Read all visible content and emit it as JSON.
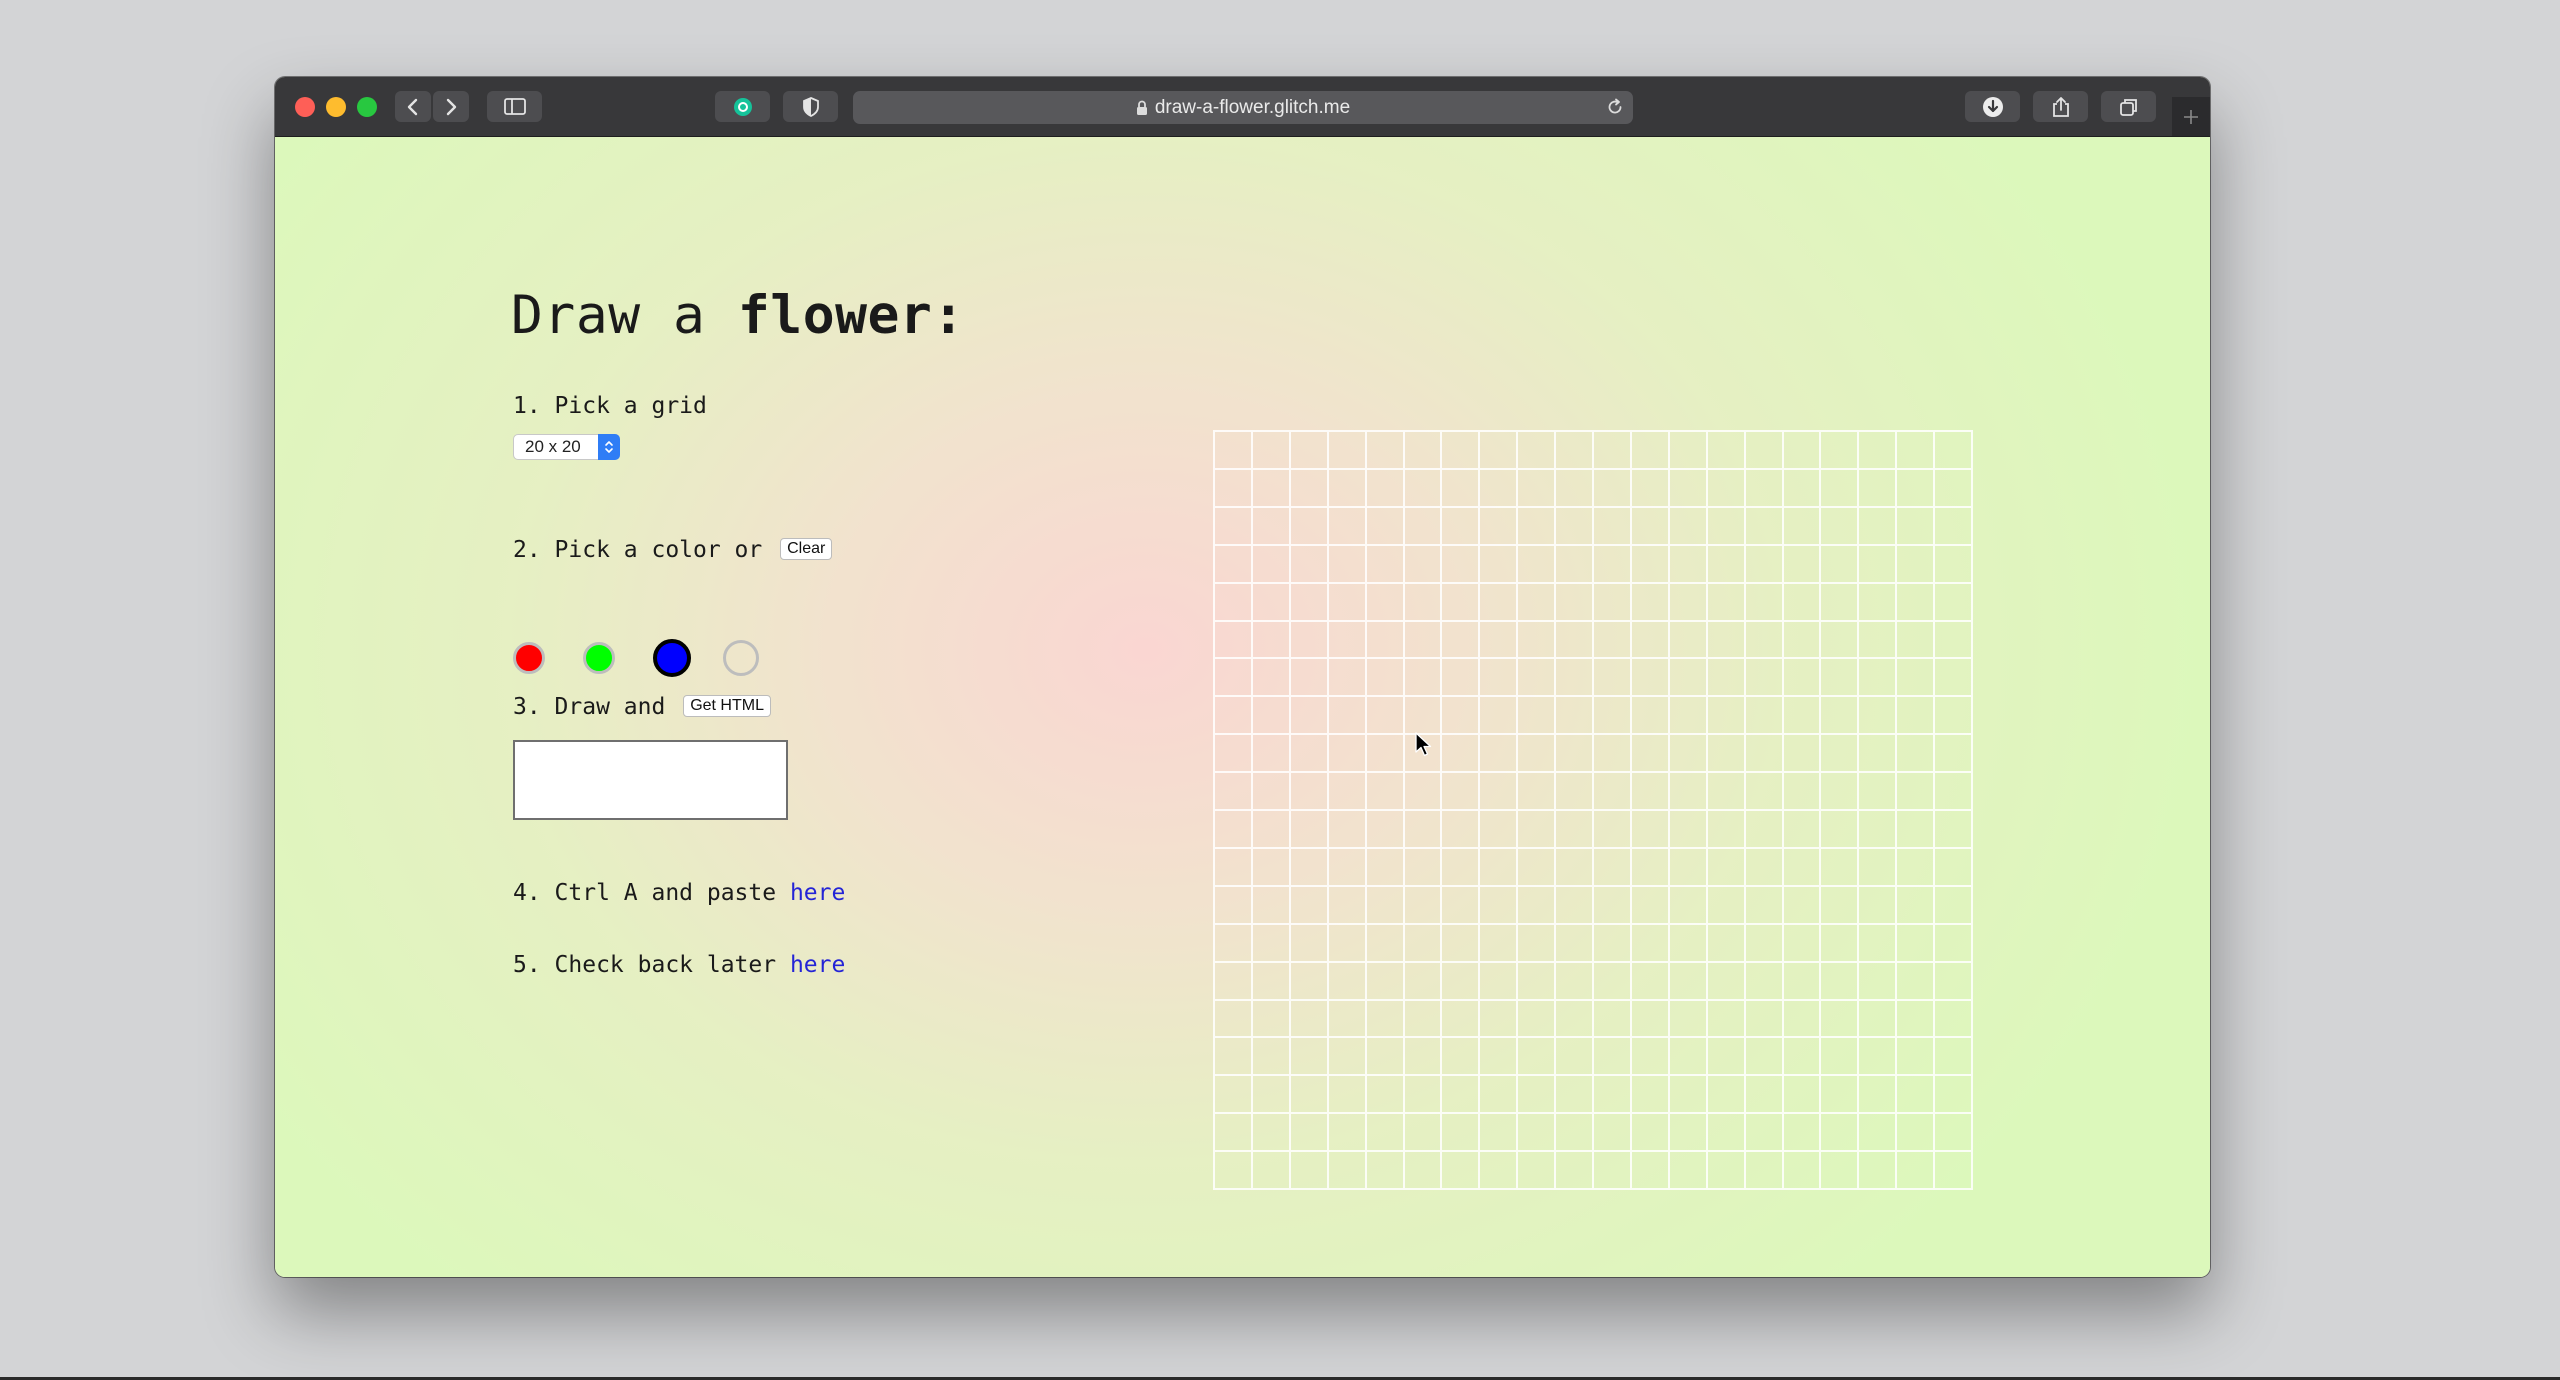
{
  "browser": {
    "url": "draw-a-flower.glitch.me"
  },
  "page": {
    "title_prefix": "Draw a ",
    "title_bold": "flower:",
    "step1": {
      "text": "1. Pick a grid",
      "select_value": "20 x 20",
      "grid_size": 20
    },
    "step2": {
      "text": "2. Pick a color or",
      "clear_label": "Clear",
      "colors": [
        "#ff0000",
        "#00ff00",
        "#0000ff",
        "transparent"
      ],
      "selected_color": "#0000ff"
    },
    "step3": {
      "text": "3. Draw and",
      "get_html_label": "Get HTML",
      "output_value": ""
    },
    "step4": {
      "text": "4. Ctrl A and paste ",
      "link_label": "here"
    },
    "step5": {
      "text": "5. Check back later ",
      "link_label": "here"
    }
  }
}
